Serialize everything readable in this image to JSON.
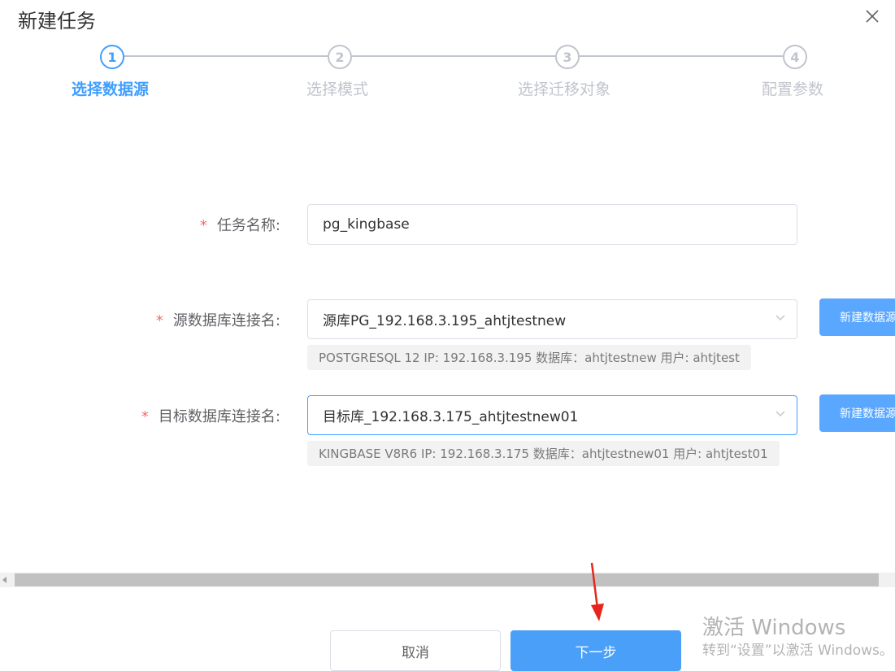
{
  "dialog": {
    "title": "新建任务",
    "close_icon": "close-icon"
  },
  "steps": [
    {
      "number": "1",
      "label": "选择数据源",
      "active": true
    },
    {
      "number": "2",
      "label": "选择模式",
      "active": false
    },
    {
      "number": "3",
      "label": "选择迁移对象",
      "active": false
    },
    {
      "number": "4",
      "label": "配置参数",
      "active": false
    }
  ],
  "form": {
    "task_name": {
      "required_mark": "*",
      "label": "任务名称:",
      "value": "pg_kingbase"
    },
    "source": {
      "required_mark": "*",
      "label": "源数据库连接名:",
      "value": "源库PG_192.168.3.195_ahtjtestnew",
      "info": "POSTGRESQL 12 IP: 192.168.3.195 数据库：ahtjtestnew 用户: ahtjtest",
      "new_button": "新建数据源"
    },
    "target": {
      "required_mark": "*",
      "label": "目标数据库连接名:",
      "value": "目标库_192.168.3.175_ahtjtestnew01",
      "info": "KINGBASE V8R6 IP: 192.168.3.175 数据库：ahtjtestnew01 用户: ahtjtest01",
      "new_button": "新建数据源"
    }
  },
  "footer": {
    "cancel": "取消",
    "next": "下一步"
  },
  "watermark": {
    "line1": "激活 Windows",
    "line2": "转到“设置”以激活 Windows。"
  },
  "colors": {
    "primary": "#409eff",
    "required": "#f56c6c",
    "inactive": "#c0c4cc"
  }
}
